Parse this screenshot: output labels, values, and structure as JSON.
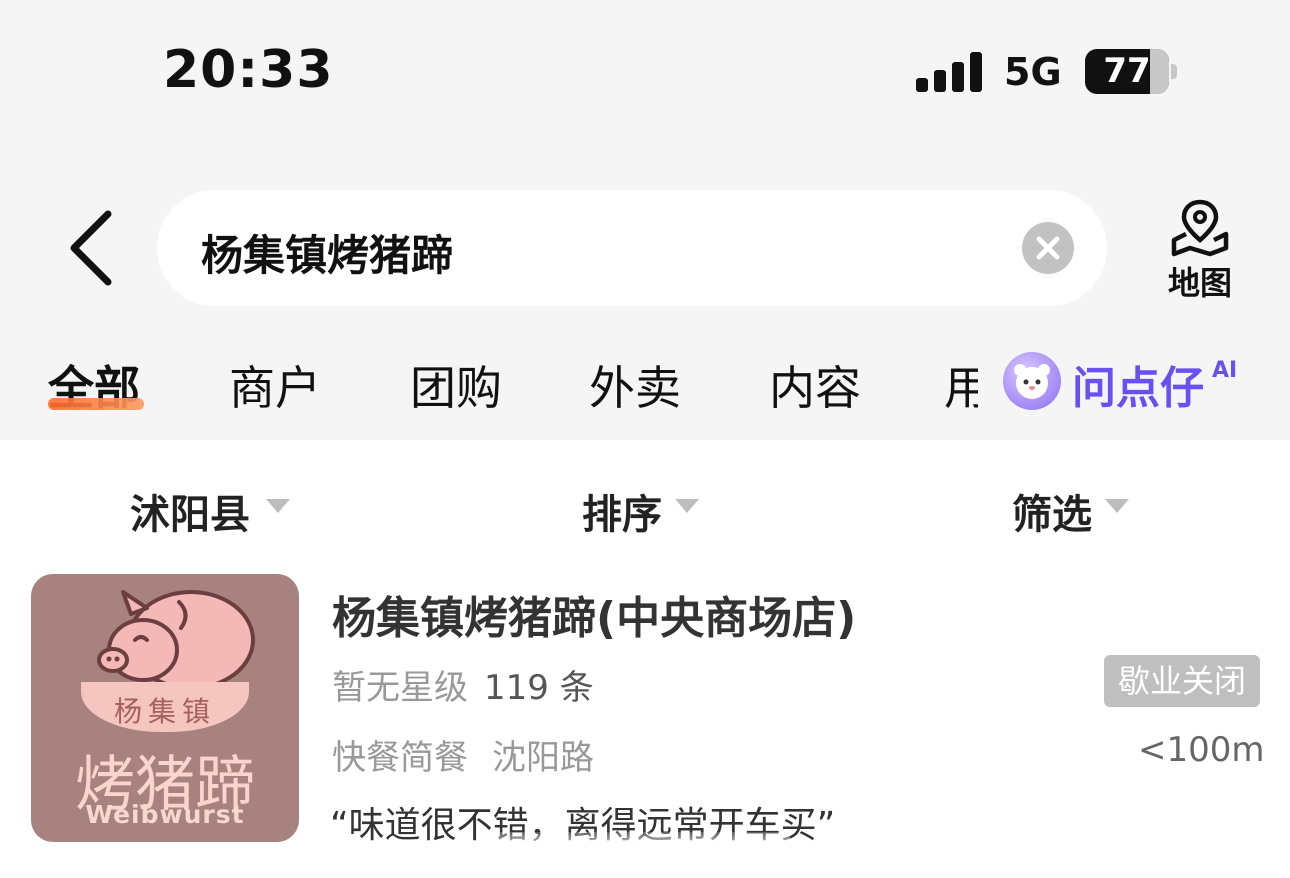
{
  "status_bar": {
    "time": "20:33",
    "network": "5G",
    "battery_level": "77",
    "battery_fraction": 0.77
  },
  "search": {
    "query": "杨集镇烤猪蹄",
    "map_label": "地图"
  },
  "tabs": [
    {
      "label": "全部",
      "active": true
    },
    {
      "label": "商户",
      "active": false
    },
    {
      "label": "团购",
      "active": false
    },
    {
      "label": "外卖",
      "active": false
    },
    {
      "label": "内容",
      "active": false
    },
    {
      "label": "用",
      "active": false
    }
  ],
  "assistant": {
    "label": "问点仔",
    "badge": "AI",
    "color": "#6a4ff2"
  },
  "filters": [
    {
      "label": "沭阳县"
    },
    {
      "label": "排序"
    },
    {
      "label": "筛选"
    }
  ],
  "result": {
    "title": "杨集镇烤猪蹄(中央商场店)",
    "rating_text": "暂无星级",
    "review_count": "119 条",
    "status": "歇业关闭",
    "category": "快餐简餐",
    "area": "沈阳路",
    "distance": "<100m",
    "quote": "“味道很不错，离得远常开车买”",
    "thumbnail": {
      "ribbon_text": "杨集镇",
      "brand_cn": "烤猪蹄",
      "brand_en": "Weibwurst"
    }
  },
  "colors": {
    "accent_orange": "#ff6a2b",
    "closed_badge": "#bfbfbf",
    "thumb_background": "#a8827f"
  }
}
